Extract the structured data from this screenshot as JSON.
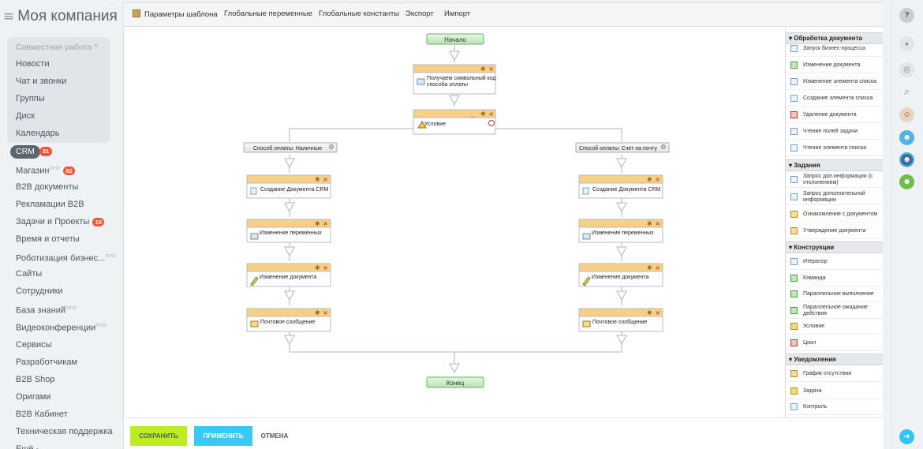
{
  "sidebar": {
    "logo": {
      "menu_glyph": "≡",
      "name": "Моя компания",
      "overflow": "2"
    },
    "group_title": "Совместная работа ^",
    "items": [
      {
        "label": "Новости"
      },
      {
        "label": "Чат и звонки"
      },
      {
        "label": "Группы"
      },
      {
        "label": "Диск"
      },
      {
        "label": "Календарь"
      }
    ],
    "crm": {
      "label": "CRM",
      "count": "31"
    },
    "items2": [
      {
        "label": "Магазин",
        "beta": "beta",
        "count": "82"
      },
      {
        "label": "B2B документы"
      },
      {
        "label": "Рекламации B2B"
      },
      {
        "label": "Задачи и Проекты",
        "count": "10"
      },
      {
        "label": "Время и отчеты"
      },
      {
        "label": "Роботизация бизнес...",
        "beta": "beta"
      },
      {
        "label": "Сайты"
      },
      {
        "label": "Сотрудники"
      },
      {
        "label": "База знаний",
        "beta": "beta"
      },
      {
        "label": "Видеоконференции",
        "beta": "beta"
      },
      {
        "label": "Сервисы"
      },
      {
        "label": "Разработчикам"
      },
      {
        "label": "B2B Shop"
      },
      {
        "label": "Оригами"
      },
      {
        "label": "B2B Кабинет"
      },
      {
        "label": "Техническая поддержка"
      },
      {
        "label": "Ещё -"
      }
    ]
  },
  "toolbar": {
    "template_params": "Параметры шаблона",
    "global_vars": "Глобальные переменные",
    "global_consts": "Глобальные константы",
    "export": "Экспорт",
    "import": "Импорт"
  },
  "flow": {
    "start": "Начало",
    "end": "Конец",
    "step1_line1": "Получаем символьный код",
    "step1_line2": "способа оплаты",
    "condition": "Условие",
    "branch_left": "Способ оплаты: Наличные",
    "branch_right": "Способ оплаты: Счет на почту",
    "act_create_doc": "Создание Документа CRM",
    "act_change_vars": "Изменение переменных",
    "act_change_doc": "Изменение документа",
    "act_mail": "Почтовое сообщение"
  },
  "activities": {
    "doc_processing": {
      "title": "▾ Обработка документа",
      "items": [
        {
          "label": "Запуск бизнес-процесса",
          "icon": "doc-icon"
        },
        {
          "label": "Изменение документа",
          "icon": "pencil-icon"
        },
        {
          "label": "Изменение элемента списка",
          "icon": "doc-icon"
        },
        {
          "label": "Создание элемента списка",
          "icon": "doc-icon"
        },
        {
          "label": "Удаление документа",
          "icon": "delete-icon"
        },
        {
          "label": "Чтение полей задачи",
          "icon": "doc-icon"
        },
        {
          "label": "Чтение элемента списка",
          "icon": "doc-icon"
        }
      ]
    },
    "tasks": {
      "title": "▾ Задания",
      "items": [
        {
          "label1": "Запрос доп.информации (с",
          "label2": "отклонением)",
          "icon": "doc-icon"
        },
        {
          "label1": "Запрос дополнительной",
          "label2": "информации",
          "icon": "doc-icon"
        },
        {
          "label": "Ознакомление с документом",
          "icon": "info-icon"
        },
        {
          "label": "Утверждение документа",
          "icon": "info-icon"
        }
      ]
    },
    "constructs": {
      "title": "▾ Конструкции",
      "items": [
        {
          "label": "Итератор",
          "icon": "doc-icon"
        },
        {
          "label": "Команда",
          "icon": "arrow-icon"
        },
        {
          "label": "Параллельное выполнение",
          "icon": "parallel-icon"
        },
        {
          "label1": "Параллельное ожидание",
          "label2": "действия",
          "icon": "parallel-icon"
        },
        {
          "label": "Условие",
          "icon": "condition-icon"
        },
        {
          "label": "Цикл",
          "icon": "loop-icon"
        }
      ]
    },
    "notifications": {
      "title": "▾ Уведомления",
      "items": [
        {
          "label": "График отсутствия",
          "icon": "calendar-icon"
        },
        {
          "label": "Задача",
          "icon": "task-icon"
        },
        {
          "label": "Контроль",
          "icon": "doc-icon"
        }
      ]
    }
  },
  "buttons": {
    "save": "СОХРАНИТЬ",
    "apply": "ПРИМЕНИТЬ",
    "cancel": "ОТМЕНА"
  },
  "rail": {
    "help": "?",
    "bell": "●",
    "chat": "◎",
    "search": "⌕",
    "users": "☻",
    "group": "☻",
    "team": "☻",
    "exit": "➜"
  },
  "colors": {
    "accent_green": "#bbed21",
    "accent_blue": "#3bc8f5",
    "badge_red": "#f0563c",
    "activity_header": "#f7cf86",
    "start_end": "#c5ebc2"
  }
}
